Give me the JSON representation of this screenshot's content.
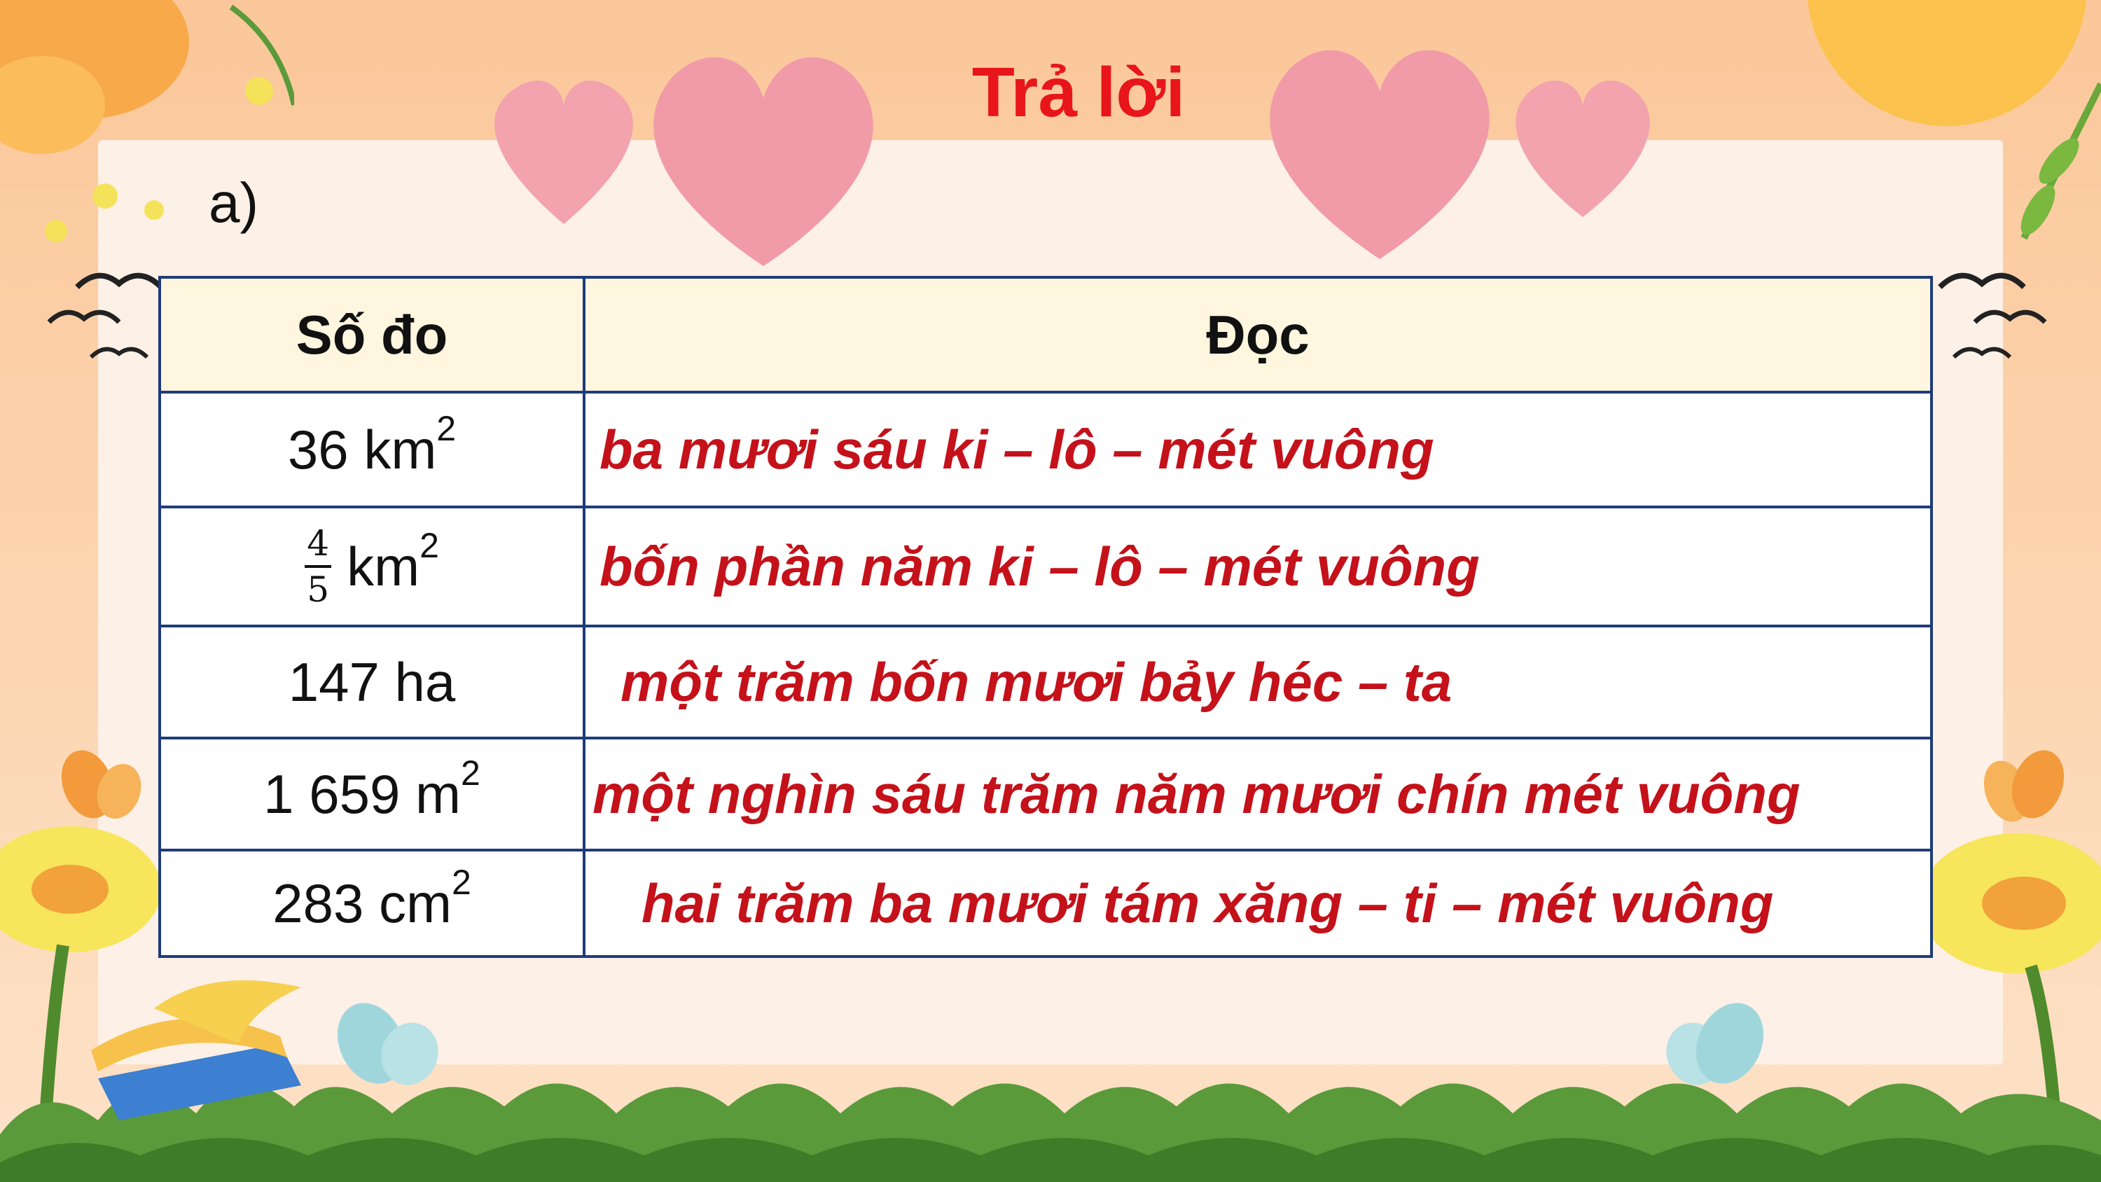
{
  "title": "Trả lời",
  "part_label": "a)",
  "table": {
    "headers": [
      "Số đo",
      "Đọc"
    ],
    "rows": [
      {
        "value": "36 km",
        "sup": "2",
        "reading": "ba mươi sáu ki – lô – mét vuông"
      },
      {
        "numerator": "4",
        "denominator": "5",
        "value": "km",
        "sup": "2",
        "reading": "bốn phần năm ki – lô – mét vuông"
      },
      {
        "value": "147 ha",
        "sup": "",
        "reading": "một trăm bốn mươi bảy héc – ta"
      },
      {
        "value": "1 659 m",
        "sup": "2",
        "reading": "một nghìn sáu trăm năm mươi chín mét vuông"
      },
      {
        "value": "283 cm",
        "sup": "2",
        "reading": "hai trăm ba mươi tám xăng – ti – mét vuông"
      }
    ]
  },
  "colors": {
    "title": "#e8151b",
    "reading": "#c4111a",
    "border": "#1f3b7a",
    "header_bg": "#fef6df"
  }
}
